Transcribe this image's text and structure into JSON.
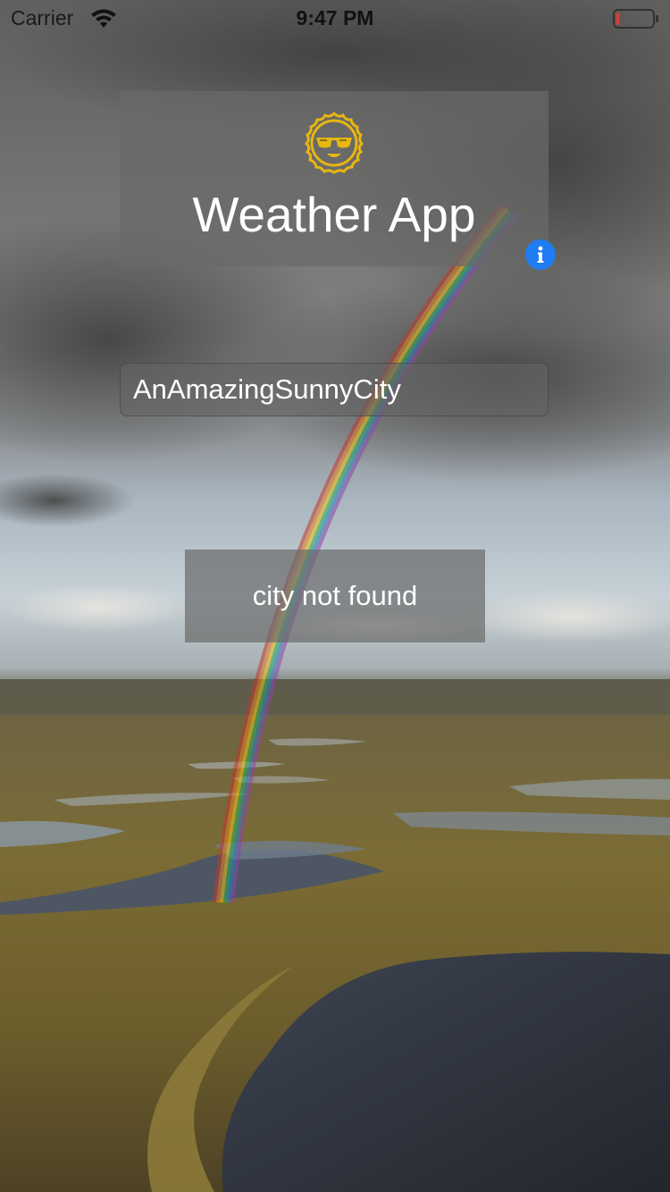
{
  "status_bar": {
    "carrier": "Carrier",
    "time": "9:47 PM",
    "battery_level": 0.08
  },
  "header": {
    "logo_icon": "sun-with-sunglasses-icon",
    "title": "Weather App",
    "info_icon": "info-icon"
  },
  "search": {
    "value": "AnAmazingSunnyCity"
  },
  "result": {
    "message": "city not found"
  },
  "colors": {
    "logo": "#e8b60f",
    "info_button": "#1f7cf2",
    "card_overlay": "#696969",
    "battery_low": "#e53935"
  }
}
